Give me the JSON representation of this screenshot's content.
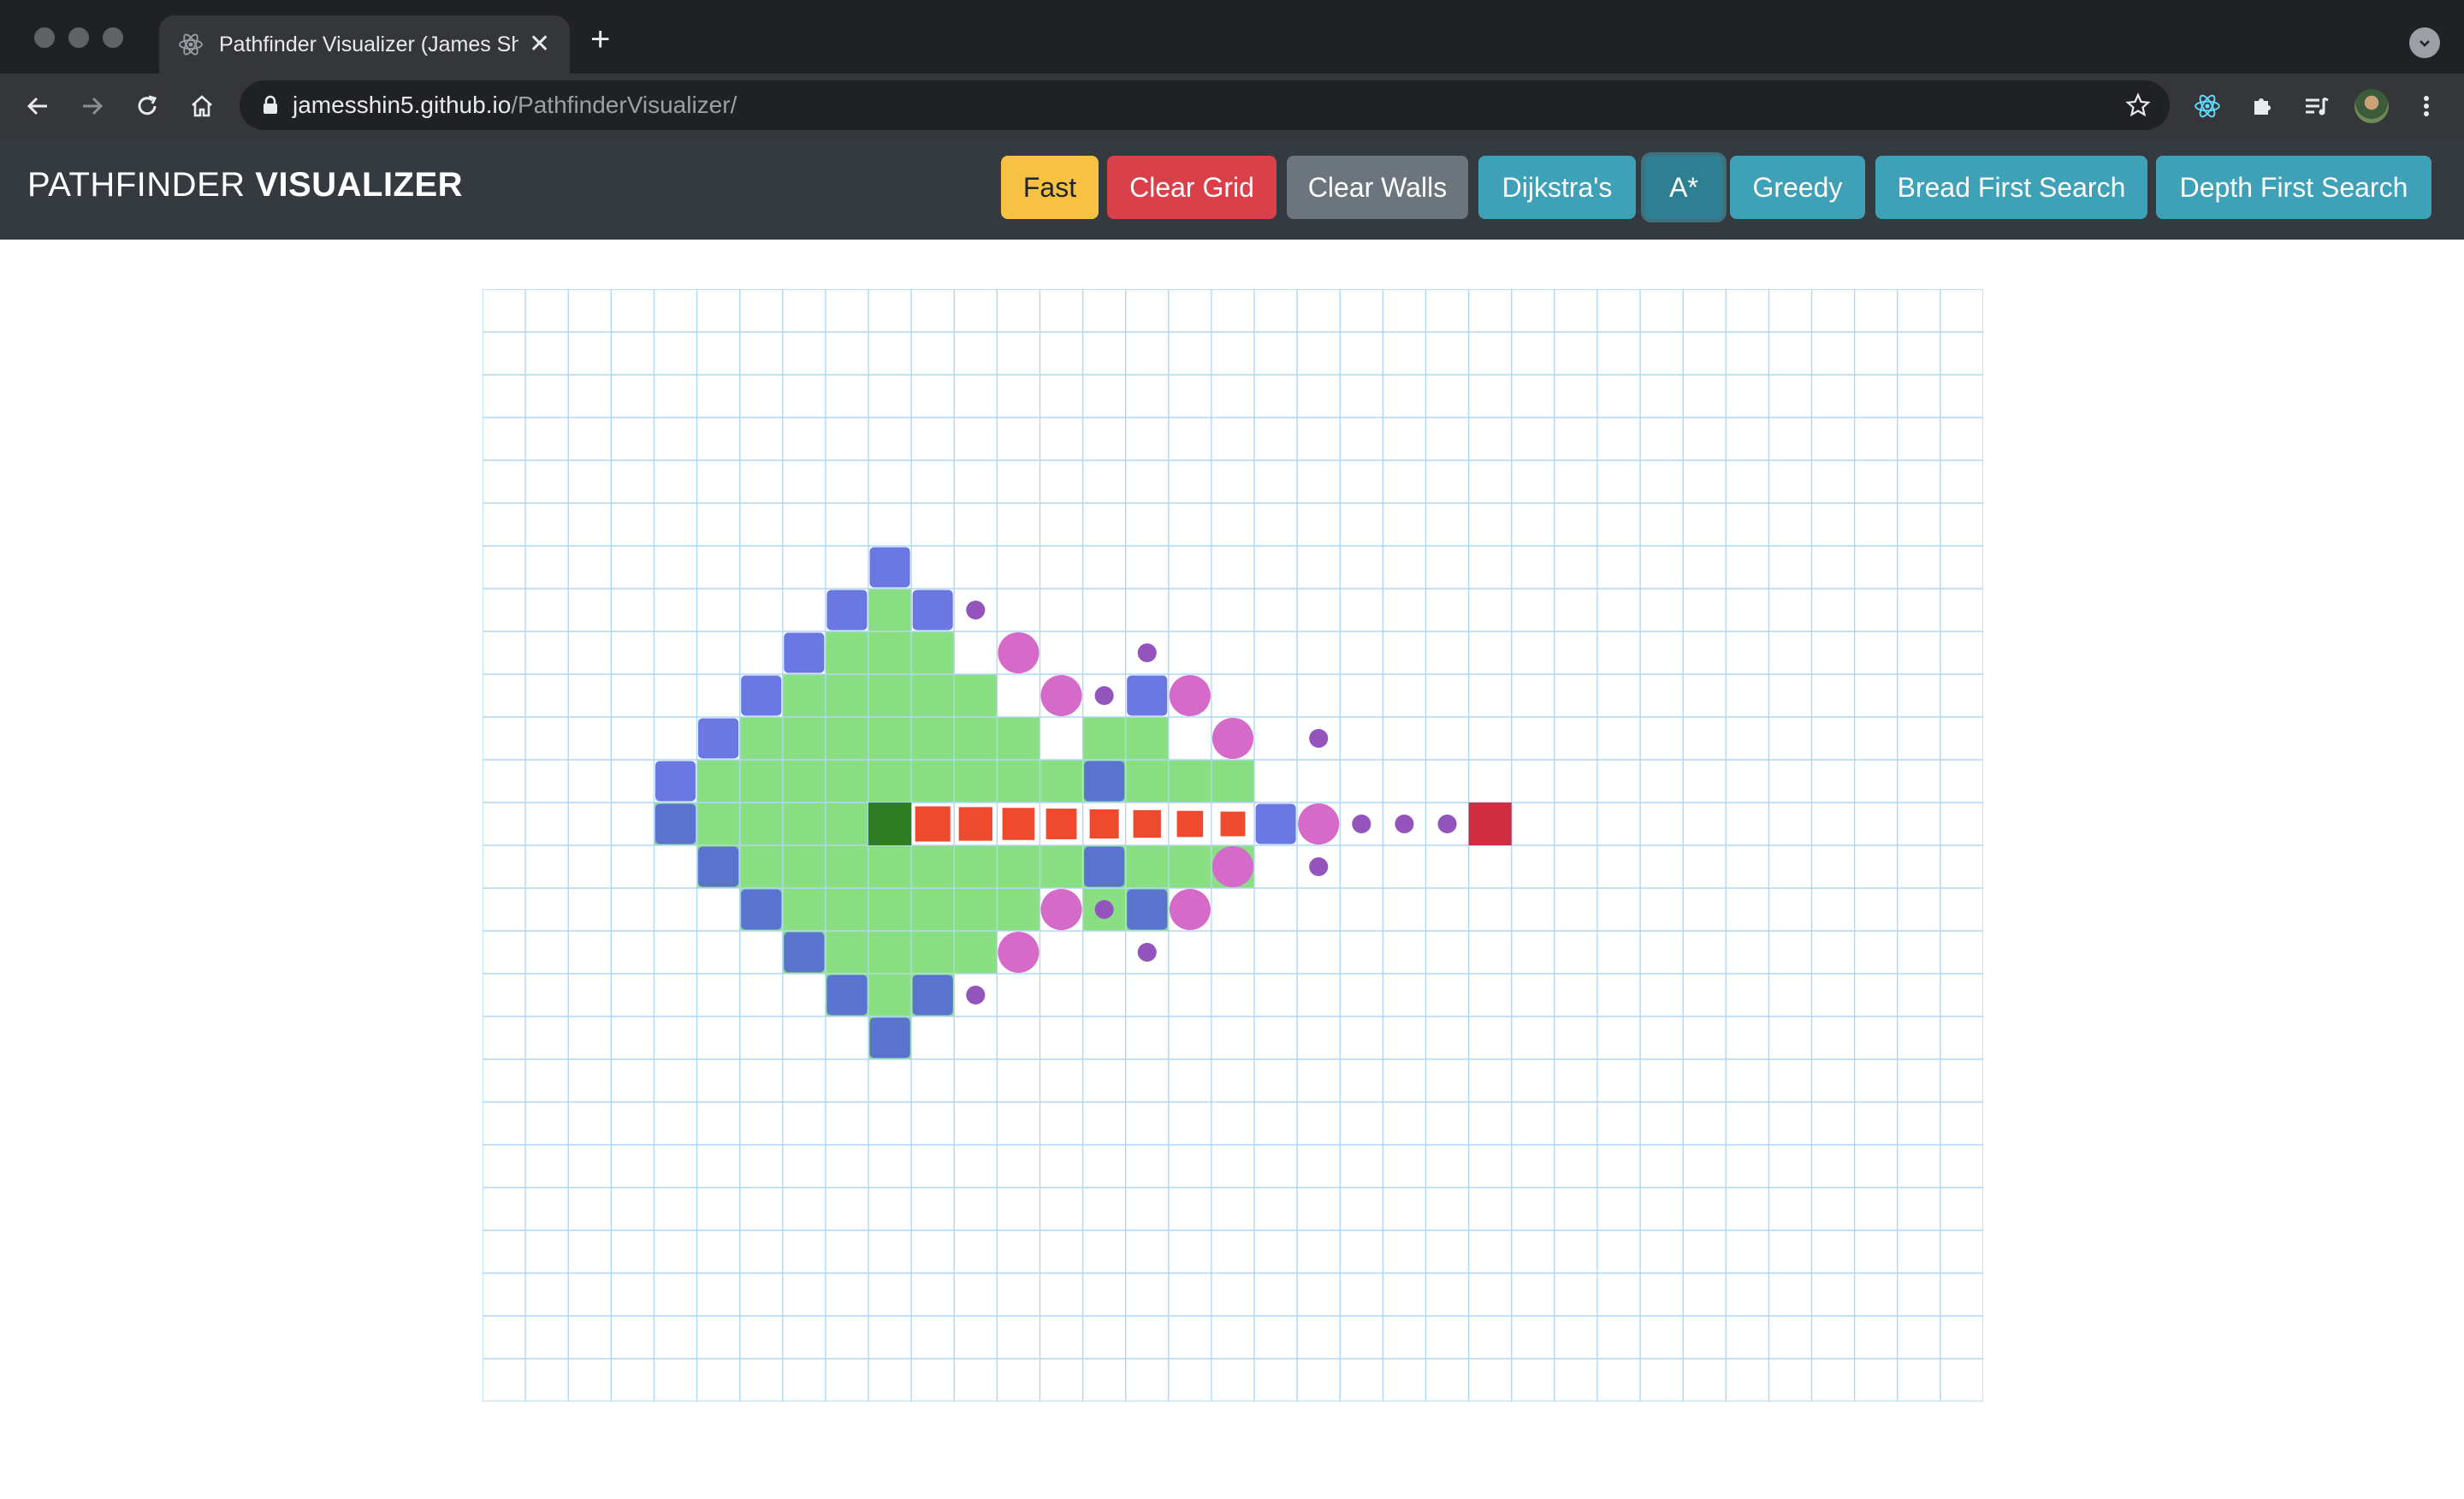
{
  "browser": {
    "tab_title": "Pathfinder Visualizer (James Shin)",
    "url_host": "jamesshin5.github.io",
    "url_path": "/PathfinderVisualizer/",
    "newtab_label": "+",
    "close_label": "✕"
  },
  "app": {
    "brand_light": "PATHFINDER",
    "brand_bold": "VISUALIZER",
    "buttons": {
      "speed": "Fast",
      "clear_grid": "Clear Grid",
      "clear_walls": "Clear Walls",
      "dijkstra": "Dijkstra's",
      "astar": "A*",
      "greedy": "Greedy",
      "bfs": "Bread First Search",
      "dfs": "Depth First Search"
    },
    "active_algorithm": "A*"
  },
  "colors": {
    "speed": "#f7c244",
    "clear_grid": "#d9404a",
    "clear_walls": "#6c757d",
    "algo": "#3ea1b8",
    "algo_active": "#2f7f93",
    "navbar": "#343a40",
    "grid_line": "#afd8f8",
    "visited_green": "#8bdf83",
    "frontier_blue": "#5160dc",
    "open_magenta": "#d56ac9",
    "open_purple": "#9354bb",
    "path_red": "#ee4a2e",
    "start": "#2d7b23",
    "target": "#cf2d41"
  },
  "grid": {
    "rows": 26,
    "cols": 35,
    "start": [
      12,
      9
    ],
    "target": [
      12,
      23
    ],
    "path": [
      [
        12,
        10
      ],
      [
        12,
        11
      ],
      [
        12,
        12
      ],
      [
        12,
        13
      ],
      [
        12,
        14
      ],
      [
        12,
        15
      ],
      [
        12,
        16
      ],
      [
        12,
        17
      ]
    ],
    "visited": [
      [
        7,
        9
      ],
      [
        8,
        8
      ],
      [
        8,
        9
      ],
      [
        8,
        10
      ],
      [
        9,
        7
      ],
      [
        9,
        8
      ],
      [
        9,
        9
      ],
      [
        9,
        10
      ],
      [
        9,
        11
      ],
      [
        10,
        6
      ],
      [
        10,
        7
      ],
      [
        10,
        8
      ],
      [
        10,
        9
      ],
      [
        10,
        10
      ],
      [
        10,
        11
      ],
      [
        10,
        12
      ],
      [
        10,
        14
      ],
      [
        10,
        15
      ],
      [
        11,
        5
      ],
      [
        11,
        6
      ],
      [
        11,
        7
      ],
      [
        11,
        8
      ],
      [
        11,
        9
      ],
      [
        11,
        10
      ],
      [
        11,
        11
      ],
      [
        11,
        12
      ],
      [
        11,
        13
      ],
      [
        11,
        14
      ],
      [
        11,
        15
      ],
      [
        11,
        16
      ],
      [
        11,
        17
      ],
      [
        12,
        4
      ],
      [
        12,
        5
      ],
      [
        12,
        6
      ],
      [
        12,
        7
      ],
      [
        12,
        8
      ],
      [
        13,
        5
      ],
      [
        13,
        6
      ],
      [
        13,
        7
      ],
      [
        13,
        8
      ],
      [
        13,
        9
      ],
      [
        13,
        10
      ],
      [
        13,
        11
      ],
      [
        13,
        12
      ],
      [
        13,
        13
      ],
      [
        13,
        14
      ],
      [
        13,
        15
      ],
      [
        13,
        16
      ],
      [
        13,
        17
      ],
      [
        14,
        6
      ],
      [
        14,
        7
      ],
      [
        14,
        8
      ],
      [
        14,
        9
      ],
      [
        14,
        10
      ],
      [
        14,
        11
      ],
      [
        14,
        12
      ],
      [
        14,
        14
      ],
      [
        14,
        15
      ],
      [
        15,
        7
      ],
      [
        15,
        8
      ],
      [
        15,
        9
      ],
      [
        15,
        10
      ],
      [
        15,
        11
      ],
      [
        16,
        8
      ],
      [
        16,
        9
      ],
      [
        16,
        10
      ],
      [
        17,
        9
      ]
    ],
    "frontier_squares": [
      [
        6,
        9
      ],
      [
        7,
        8
      ],
      [
        8,
        7
      ],
      [
        9,
        6
      ],
      [
        10,
        5
      ],
      [
        11,
        4
      ],
      [
        12,
        4
      ],
      [
        13,
        5
      ],
      [
        14,
        6
      ],
      [
        15,
        7
      ],
      [
        16,
        8
      ],
      [
        17,
        9
      ],
      [
        7,
        10
      ],
      [
        16,
        10
      ],
      [
        11,
        14
      ],
      [
        13,
        14
      ],
      [
        9,
        15
      ],
      [
        14,
        15
      ],
      [
        12,
        18
      ]
    ],
    "open_circles_large": [
      [
        8,
        12
      ],
      [
        9,
        13
      ],
      [
        9,
        16
      ],
      [
        10,
        17
      ],
      [
        12,
        19
      ],
      [
        14,
        13
      ],
      [
        14,
        16
      ],
      [
        13,
        17
      ],
      [
        15,
        12
      ]
    ],
    "open_circles_small": [
      [
        7,
        11
      ],
      [
        8,
        15
      ],
      [
        9,
        14
      ],
      [
        10,
        19
      ],
      [
        12,
        20
      ],
      [
        12,
        21
      ],
      [
        12,
        22
      ],
      [
        13,
        19
      ],
      [
        14,
        14
      ],
      [
        15,
        15
      ],
      [
        16,
        11
      ]
    ]
  }
}
